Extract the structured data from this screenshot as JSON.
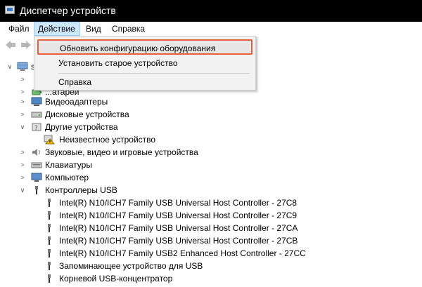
{
  "window": {
    "title": "Диспетчер устройств",
    "icon": "device-manager-icon"
  },
  "menubar": {
    "file": "Файл",
    "action": "Действие",
    "view": "Вид",
    "help": "Справка"
  },
  "toolbar": {
    "back": "arrow-left-icon",
    "forward": "arrow-right-icon"
  },
  "action_menu": {
    "items": [
      {
        "label": "Обновить конфигурацию оборудования",
        "highlighted": true
      },
      {
        "label": "Установить старое устройство",
        "highlighted": false
      },
      {
        "label": "Справка",
        "highlighted": false
      }
    ]
  },
  "tree": {
    "root_label": "s",
    "categories": [
      {
        "label": "...атареи",
        "expanded": false
      },
      {
        "label": "Видеоадаптеры",
        "expanded": false
      },
      {
        "label": "Дисковые устройства",
        "expanded": false
      },
      {
        "label": "Другие устройства",
        "expanded": true
      },
      {
        "label": "Неизвестное устройство",
        "child": true,
        "icon": "unknown-device-warning-icon"
      },
      {
        "label": "Звуковые, видео и игровые устройства",
        "expanded": false
      },
      {
        "label": "Клавиатуры",
        "expanded": false
      },
      {
        "label": "Компьютер",
        "expanded": false
      },
      {
        "label": "Контроллеры USB",
        "expanded": true
      }
    ],
    "usb_devices": [
      "Intel(R) N10/ICH7 Family USB Universal Host Controller - 27C8",
      "Intel(R) N10/ICH7 Family USB Universal Host Controller - 27C9",
      "Intel(R) N10/ICH7 Family USB Universal Host Controller - 27CA",
      "Intel(R) N10/ICH7 Family USB Universal Host Controller - 27CB",
      "Intel(R) N10/ICH7 Family USB2 Enhanced Host Controller - 27CC",
      "Запоминающее устройство для USB",
      "Корневой USB-концентратор"
    ]
  },
  "colors": {
    "highlight_border": "#e8603c",
    "menu_bg": "#f2f2f2",
    "active_menu": "#cce8ff"
  }
}
